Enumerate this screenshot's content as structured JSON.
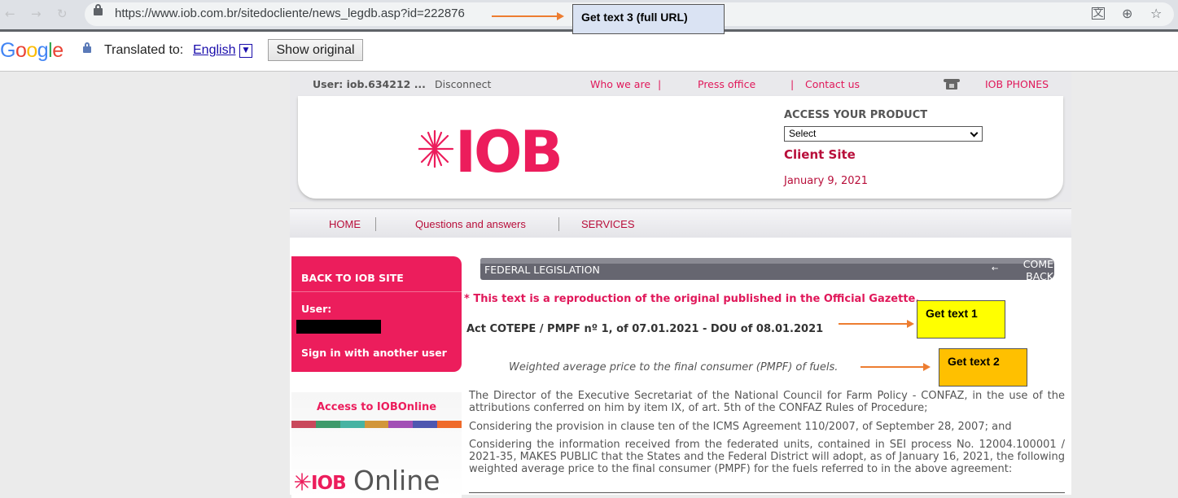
{
  "browser": {
    "url": "https://www.iob.com.br/sitedocliente/news_legdb.asp?id=222876"
  },
  "translate_bar": {
    "logo_text": "Google",
    "translated_to_label": "Translated to:",
    "language": "English",
    "language_dropdown_glyph": "▼",
    "show_original_label": "Show original"
  },
  "top_strip": {
    "user": "User: iob.634212 ...",
    "disconnect": "Disconnect",
    "who_we_are": "Who we are",
    "sep1": "|",
    "press_office": "Press office",
    "sep2": "|",
    "contact_us": "Contact us",
    "phones": "IOB PHONES"
  },
  "header": {
    "logo_text": "IOB",
    "access_label": "ACCESS YOUR PRODUCT",
    "product_select_value": "Select",
    "client_site": "Client Site",
    "date": "January 9, 2021"
  },
  "menu": {
    "items": [
      "HOME",
      "Questions and answers",
      "SERVICES"
    ]
  },
  "sidebar": {
    "back_to_site": "BACK TO IOB SITE",
    "user_label": "User:",
    "sign_in_another": "Sign in with another user",
    "iobonline_title": "Access to IOBOnline",
    "iobonline_logo_brand": "IOB",
    "iobonline_logo_word": "Online",
    "strip_colors": [
      "#c9485b",
      "#3f9a6b",
      "#46b3a3",
      "#d2963a",
      "#a24fb5",
      "#4e57b0",
      "#ef6a2a"
    ]
  },
  "article": {
    "section_title": "FEDERAL LEGISLATION",
    "come_back_arrow": "←",
    "come_back": "COME BACK",
    "reproduction_note": "* This text is a reproduction of the original published in the Official Gazette.",
    "act_title": "Act COTEPE / PMPF nº 1, of 07.01.2021 - DOU of 08.01.2021",
    "subtitle": "Weighted average price to the final consumer (PMPF) of fuels.",
    "paragraphs": [
      "The Director of the Executive Secretariat of the National Council for Farm Policy - CONFAZ, in the use of the attributions conferred on him by item IX, of art. 5th of the CONFAZ Rules of Procedure;",
      "Considering the provision in clause ten of the ICMS Agreement 110/2007, of September 28, 2007; and",
      "Considering the information received from the federated units, contained in SEI process No. 12004.100001 / 2021-35, MAKES PUBLIC that the States and the Federal District will adopt, as of January 16, 2021, the following weighted average price to the final consumer (PMPF) for the fuels referred to in the above agreement:"
    ]
  },
  "annotations": {
    "text1": "Get text 1",
    "text2": "Get text 2",
    "text3": "Get text 3 (full URL)"
  },
  "colors": {
    "brand_pink": "#ec1d5c",
    "link_red": "#b80e3a",
    "annotation_orange": "#ed7d31",
    "annotation_yellow": "#ffff00",
    "annotation_gold": "#ffc000",
    "annotation_blue": "#dae3f3"
  }
}
